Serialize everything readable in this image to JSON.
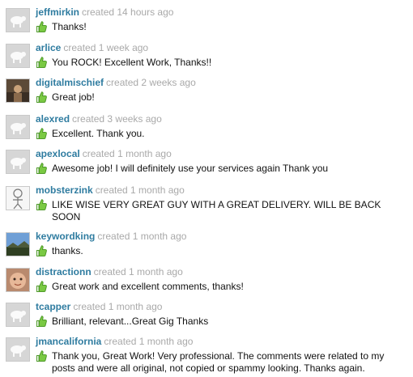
{
  "reviews": [
    {
      "username": "jeffmirkin",
      "created": "created 14 hours ago",
      "comment": "Thanks!",
      "avatar": "sheep-placeholder-icon",
      "rating": "thumbs-up"
    },
    {
      "username": "arlice",
      "created": "created 1 week ago",
      "comment": "You ROCK! Excellent Work, Thanks!!",
      "avatar": "sheep-placeholder-icon",
      "rating": "thumbs-up"
    },
    {
      "username": "digitalmischief",
      "created": "created 2 weeks ago",
      "comment": "Great job!",
      "avatar": "profile-photo",
      "rating": "thumbs-up"
    },
    {
      "username": "alexred",
      "created": "created 3 weeks ago",
      "comment": "Excellent. Thank you.",
      "avatar": "sheep-placeholder-icon",
      "rating": "thumbs-up"
    },
    {
      "username": "apexlocal",
      "created": "created 1 month ago",
      "comment": "Awesome job! I will definitely use your services again Thank you",
      "avatar": "sheep-placeholder-icon",
      "rating": "thumbs-up"
    },
    {
      "username": "mobsterzink",
      "created": "created 1 month ago",
      "comment": "LIKE WISE VERY GREAT GUY WITH A GREAT DELIVERY. WILL BE BACK SOON",
      "avatar": "cartoon-figure",
      "rating": "thumbs-up"
    },
    {
      "username": "keywordking",
      "created": "created 1 month ago",
      "comment": "thanks.",
      "avatar": "landscape-photo",
      "rating": "thumbs-up"
    },
    {
      "username": "distractionn",
      "created": "created 1 month ago",
      "comment": "Great work and excellent comments, thanks!",
      "avatar": "baby-face-photo",
      "rating": "thumbs-up"
    },
    {
      "username": "tcapper",
      "created": "created 1 month ago",
      "comment": "Brilliant, relevant...Great Gig Thanks",
      "avatar": "sheep-placeholder-icon",
      "rating": "thumbs-up"
    },
    {
      "username": "jmancalifornia",
      "created": "created 1 month ago",
      "comment": "Thank you, Great Work! Very professional. The comments were related to my posts and were all original, not copied or spammy looking. Thanks again.",
      "avatar": "sheep-placeholder-icon",
      "rating": "thumbs-up"
    }
  ],
  "colors": {
    "username": "#2f7ca0",
    "timestamp": "#a9a9a9",
    "thumb": "#7ac943",
    "text": "#111111"
  }
}
